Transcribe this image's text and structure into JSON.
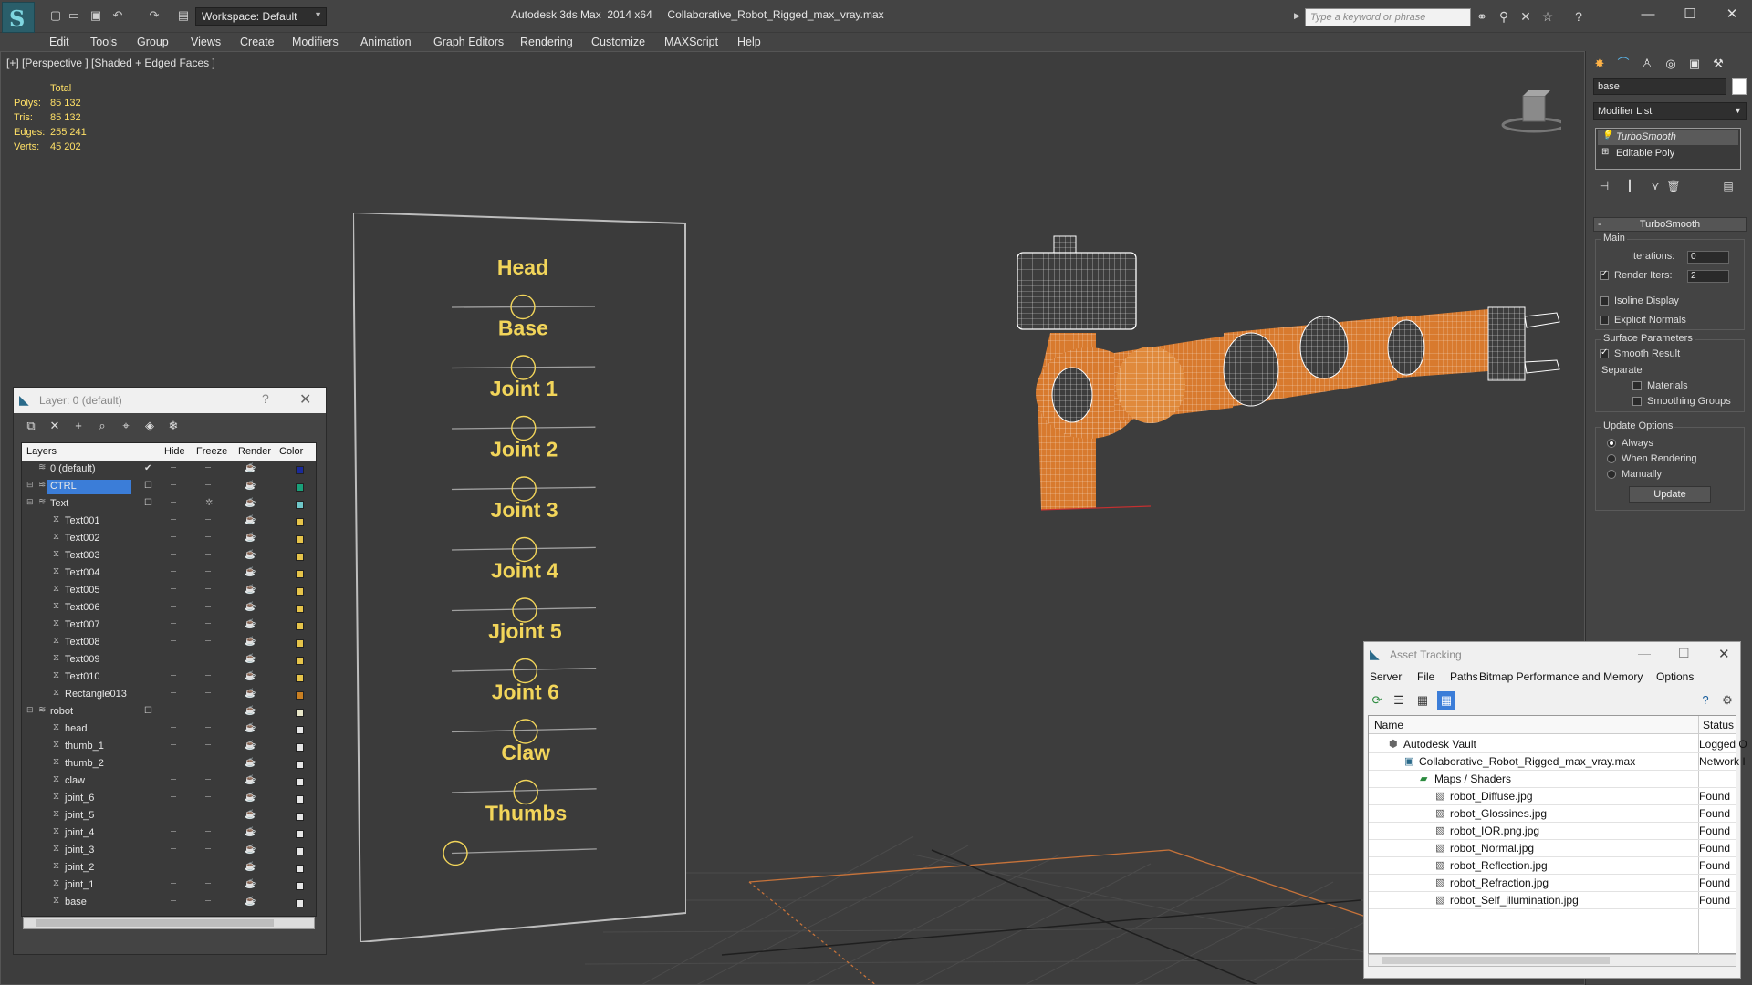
{
  "app": {
    "workspace": "Workspace: Default",
    "title": "Autodesk 3ds Max  2014 x64     Collaborative_Robot_Rigged_max_vray.max",
    "search_placeholder": "Type a keyword or phrase"
  },
  "menu": [
    "Edit",
    "Tools",
    "Group",
    "Views",
    "Create",
    "Modifiers",
    "Animation",
    "Graph Editors",
    "Rendering",
    "Customize",
    "MAXScript",
    "Help"
  ],
  "viewport": {
    "label": "[+] [Perspective ] [Shaded + Edged Faces ]",
    "stats": {
      "header": "Total",
      "rows": [
        {
          "k": "Polys:",
          "v": "85 132"
        },
        {
          "k": "Tris:",
          "v": "85 132"
        },
        {
          "k": "Edges:",
          "v": "255 241"
        },
        {
          "k": "Verts:",
          "v": "45 202"
        }
      ]
    },
    "control_labels": [
      "Head",
      "Base",
      "Joint 1",
      "Joint 2",
      "Joint 3",
      "Joint 4",
      "Jjoint 5",
      "Joint 6",
      "Claw",
      "Thumbs"
    ]
  },
  "command_panel": {
    "object_name": "base",
    "modifier_list": "Modifier List",
    "stack": [
      "TurboSmooth",
      "Editable Poly"
    ],
    "rollout_title": "TurboSmooth",
    "main_group": "Main",
    "iterations_label": "Iterations:",
    "iterations_value": "0",
    "render_iters_label": "Render Iters:",
    "render_iters_value": "2",
    "isoline_label": "Isoline Display",
    "explicit_normals_label": "Explicit Normals",
    "surface_group": "Surface Parameters",
    "smooth_result_label": "Smooth Result",
    "separate_label": "Separate",
    "materials_label": "Materials",
    "smoothing_groups_label": "Smoothing Groups",
    "update_group": "Update Options",
    "always_label": "Always",
    "when_rendering_label": "When Rendering",
    "manually_label": "Manually",
    "update_button": "Update"
  },
  "layer_explorer": {
    "title": "Layer: 0 (default)",
    "help": "?",
    "columns": [
      "Layers",
      "Hide",
      "Freeze",
      "Render",
      "Color"
    ],
    "rows": [
      {
        "name": "0 (default)",
        "level": 0,
        "color": "#1a2a9a",
        "selected": false,
        "layer": true
      },
      {
        "name": "CTRL",
        "level": 0,
        "color": "#1aa07a",
        "selected": true,
        "layer": true
      },
      {
        "name": "Text",
        "level": 0,
        "color": "#6fc7c9",
        "selected": false,
        "layer": true
      },
      {
        "name": "Text001",
        "level": 1,
        "color": "#e6c44a",
        "selected": false
      },
      {
        "name": "Text002",
        "level": 1,
        "color": "#e6c44a",
        "selected": false
      },
      {
        "name": "Text003",
        "level": 1,
        "color": "#e6c44a",
        "selected": false
      },
      {
        "name": "Text004",
        "level": 1,
        "color": "#e6c44a",
        "selected": false
      },
      {
        "name": "Text005",
        "level": 1,
        "color": "#e6c44a",
        "selected": false
      },
      {
        "name": "Text006",
        "level": 1,
        "color": "#e6c44a",
        "selected": false
      },
      {
        "name": "Text007",
        "level": 1,
        "color": "#e6c44a",
        "selected": false
      },
      {
        "name": "Text008",
        "level": 1,
        "color": "#e6c44a",
        "selected": false
      },
      {
        "name": "Text009",
        "level": 1,
        "color": "#e6c44a",
        "selected": false
      },
      {
        "name": "Text010",
        "level": 1,
        "color": "#e6c44a",
        "selected": false
      },
      {
        "name": "Rectangle013",
        "level": 1,
        "color": "#c97f22",
        "selected": false
      },
      {
        "name": "robot",
        "level": 0,
        "color": "#e8e6c8",
        "selected": false,
        "layer": true
      },
      {
        "name": "head",
        "level": 1,
        "color": "#e6e6e6",
        "selected": false
      },
      {
        "name": "thumb_1",
        "level": 1,
        "color": "#e6e6e6",
        "selected": false
      },
      {
        "name": "thumb_2",
        "level": 1,
        "color": "#e6e6e6",
        "selected": false
      },
      {
        "name": "claw",
        "level": 1,
        "color": "#e6e6e6",
        "selected": false
      },
      {
        "name": "joint_6",
        "level": 1,
        "color": "#e6e6e6",
        "selected": false
      },
      {
        "name": "joint_5",
        "level": 1,
        "color": "#e6e6e6",
        "selected": false
      },
      {
        "name": "joint_4",
        "level": 1,
        "color": "#e6e6e6",
        "selected": false
      },
      {
        "name": "joint_3",
        "level": 1,
        "color": "#e6e6e6",
        "selected": false
      },
      {
        "name": "joint_2",
        "level": 1,
        "color": "#e6e6e6",
        "selected": false
      },
      {
        "name": "joint_1",
        "level": 1,
        "color": "#e6e6e6",
        "selected": false
      },
      {
        "name": "base",
        "level": 1,
        "color": "#e6e6e6",
        "selected": false
      }
    ]
  },
  "asset_tracking": {
    "title": "Asset Tracking",
    "menu": [
      "Server",
      "File",
      "Paths",
      "Bitmap Performance and Memory",
      "Options"
    ],
    "columns": [
      "Name",
      "Status"
    ],
    "rows": [
      {
        "name": "Autodesk Vault",
        "status": "Logged O",
        "level": 0
      },
      {
        "name": "Collaborative_Robot_Rigged_max_vray.max",
        "status": "Network I",
        "level": 1
      },
      {
        "name": "Maps / Shaders",
        "status": "",
        "level": 2
      },
      {
        "name": "robot_Diffuse.jpg",
        "status": "Found",
        "level": 3
      },
      {
        "name": "robot_Glossines.jpg",
        "status": "Found",
        "level": 3
      },
      {
        "name": "robot_IOR.png.jpg",
        "status": "Found",
        "level": 3
      },
      {
        "name": "robot_Normal.jpg",
        "status": "Found",
        "level": 3
      },
      {
        "name": "robot_Reflection.jpg",
        "status": "Found",
        "level": 3
      },
      {
        "name": "robot_Refraction.jpg",
        "status": "Found",
        "level": 3
      },
      {
        "name": "robot_Self_illumination.jpg",
        "status": "Found",
        "level": 3
      }
    ]
  }
}
